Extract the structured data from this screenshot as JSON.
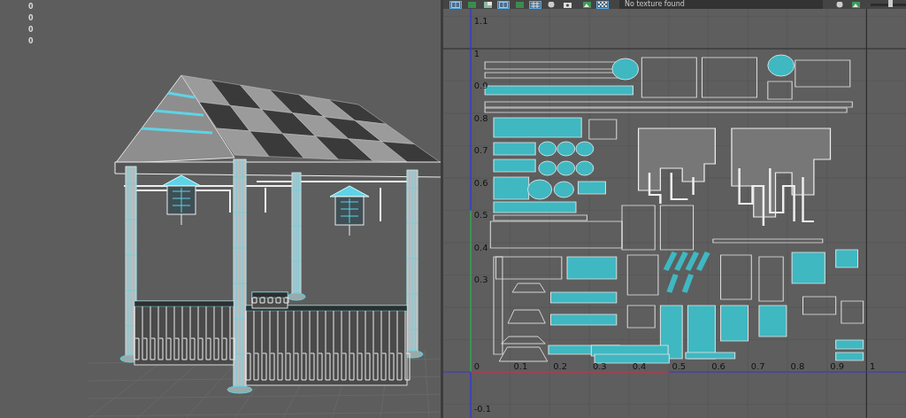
{
  "viewport": {
    "hud_values": [
      "0",
      "0",
      "0",
      "0"
    ]
  },
  "uv_editor": {
    "toolbar": [
      {
        "kind": "layout",
        "selected": true
      },
      {
        "kind": "shade",
        "selected": false
      },
      {
        "kind": "corner",
        "selected": false
      },
      {
        "kind": "layout",
        "selected": true
      },
      {
        "kind": "shade",
        "selected": false
      },
      {
        "kind": "grid",
        "selected": true
      },
      {
        "kind": "globe",
        "selected": false
      },
      {
        "kind": "camera",
        "selected": false
      }
    ],
    "right_toolbar": [
      {
        "kind": "image",
        "selected": false
      },
      {
        "kind": "checker",
        "selected": true
      }
    ],
    "texture_field": "No texture found",
    "right_icons": [
      {
        "kind": "globe",
        "selected": false
      },
      {
        "kind": "image",
        "selected": false
      }
    ],
    "slider": {
      "level": 0.55
    },
    "v_labels": [
      "1.1",
      "1",
      "0.9",
      "0.8",
      "0.7",
      "0.6",
      "0.5",
      "0.4",
      "0.3"
    ],
    "u_labels": [
      "0",
      "0.1",
      "0.2",
      "0.3",
      "0.4",
      "0.5",
      "0.6",
      "0.7",
      "0.8",
      "0.9",
      "1"
    ],
    "negative_v_label": "-0.1"
  }
}
